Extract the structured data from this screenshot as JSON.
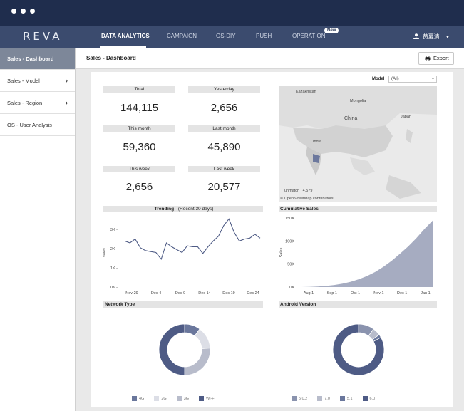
{
  "app": {
    "logo": "REVA",
    "nav": [
      "DATA ANALYTICS",
      "CAMPAIGN",
      "OS-DIY",
      "PUSH",
      "OPERATION"
    ],
    "badge": "New",
    "user": "黄夏清"
  },
  "sidebar": {
    "items": [
      {
        "label": "Sales - Dashboard"
      },
      {
        "label": "Sales - Model"
      },
      {
        "label": "Sales - Region"
      },
      {
        "label": "OS - User Analysis"
      }
    ]
  },
  "page": {
    "title": "Sales - Dashboard",
    "export_label": "Export",
    "model_label": "Model",
    "model_value": "(All)"
  },
  "kpis": [
    {
      "label": "Total",
      "value": "144,115"
    },
    {
      "label": "Yesterday",
      "value": "2,656"
    },
    {
      "label": "This month",
      "value": "59,360"
    },
    {
      "label": "Last month",
      "value": "45,890"
    },
    {
      "label": "This week",
      "value": "2,656"
    },
    {
      "label": "Last week",
      "value": "20,577"
    }
  ],
  "map": {
    "labels": [
      "Kazakhstan",
      "Mongolia",
      "China",
      "Japan",
      "India"
    ],
    "unmatch": "unmatch : 4,579",
    "credit": "© OpenStreetMap contributors"
  },
  "colors": {
    "series": "#4e5b85",
    "area": "#a6acc1",
    "nav": "#3b4b6e",
    "titlebar": "#1f2d4d"
  },
  "chart_data": [
    {
      "type": "line",
      "title": "Trending",
      "subtitle": "(Recent 30 days)",
      "ylabel": "sales",
      "xticks": [
        "Nov 29",
        "Dec 4",
        "Dec 9",
        "Dec 14",
        "Dec 19",
        "Dec 24"
      ],
      "yticks": [
        "0K",
        "1K",
        "2K",
        "3K"
      ],
      "ylim": [
        0,
        3600
      ],
      "values": [
        2400,
        2300,
        2500,
        2050,
        1900,
        1850,
        1800,
        1450,
        2300,
        2100,
        1950,
        1800,
        2150,
        2100,
        2100,
        1750,
        2100,
        2400,
        2650,
        3200,
        3550,
        2850,
        2400,
        2500,
        2550,
        2750,
        2550
      ]
    },
    {
      "type": "area",
      "title": "Cumulative Sales",
      "ylabel": "Sales",
      "xticks": [
        "Aug 1",
        "Sep 1",
        "Oct 1",
        "Nov 1",
        "Dec 1",
        "Jan 1"
      ],
      "yticks": [
        "0K",
        "50K",
        "100K",
        "150K"
      ],
      "ylim": [
        0,
        150000
      ],
      "values": [
        0,
        400,
        1200,
        2500,
        4500,
        7500,
        11500,
        17000,
        24000,
        33000,
        44000,
        57000,
        72000,
        88000,
        106000,
        126000,
        144115
      ]
    },
    {
      "type": "pie",
      "title": "Network Type",
      "categories": [
        "4G",
        "2G",
        "3G",
        "Wi-Fi"
      ],
      "values": [
        10,
        14,
        26,
        50
      ],
      "colors": [
        "#6a779c",
        "#dcdee6",
        "#b8bccb",
        "#4e5b85"
      ]
    },
    {
      "type": "pie",
      "title": "Android Version",
      "categories": [
        "5.0.2",
        "7.0",
        "5.1",
        "6.0"
      ],
      "values": [
        10,
        5,
        2,
        83
      ],
      "colors": [
        "#8a93ae",
        "#b8bccb",
        "#6a779c",
        "#4e5b85"
      ]
    }
  ]
}
